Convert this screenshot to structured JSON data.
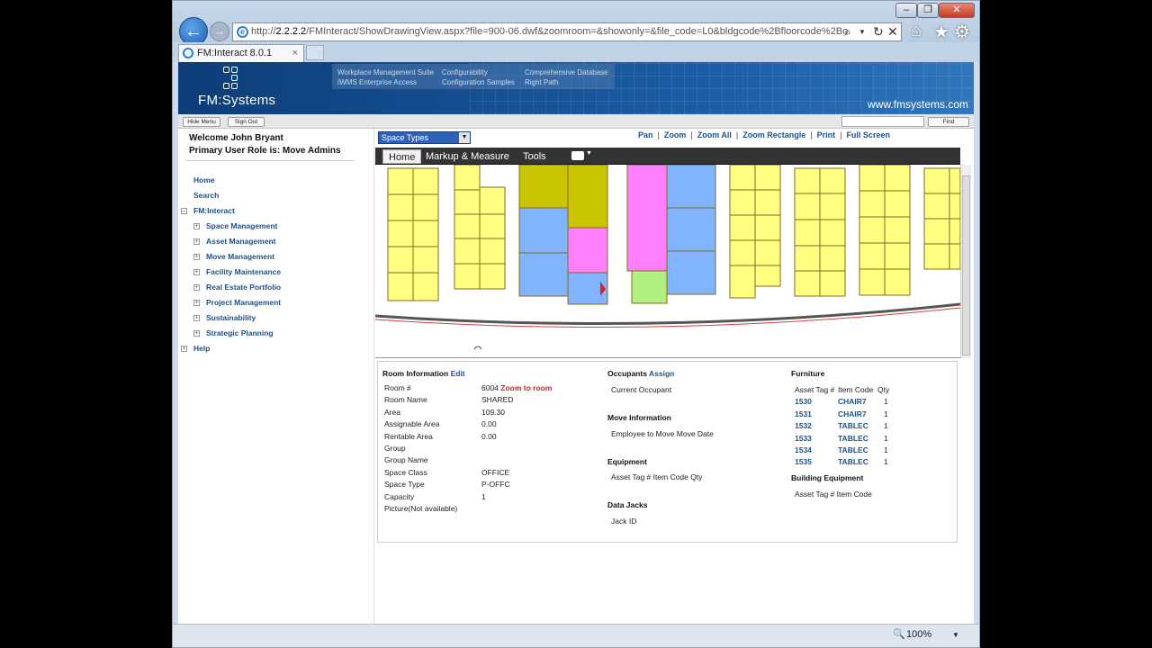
{
  "browser": {
    "url_prefix": "http://",
    "url_host": "2.2.2.2",
    "url_rest": "/FMInteract/ShowDrawingView.aspx?file=900-06.dwf&zoomroom=&showonly=&file_code=L0&bldgcode%2Bfloorcode%2Bo",
    "tab_title": "FM:Interact 8.0.1",
    "tab_close": "×",
    "zoom": "100%",
    "win_buttons": [
      "–",
      "❐",
      "✕"
    ]
  },
  "banner": {
    "logo_text": "FM:Systems",
    "site": "www.fmsystems.com",
    "links": [
      "Workplace Management Suite",
      "IWMS Enterprise Access",
      "Configurability",
      "Configuration Samples",
      "Comprehensive Database",
      "Right Path"
    ]
  },
  "toolbar": {
    "hide_menu": "Hide Menu",
    "sign_out": "Sign Out",
    "find": "Find"
  },
  "user": {
    "welcome": "Welcome John Bryant",
    "role": "Primary User Role is:  Move Admins"
  },
  "nav": {
    "home": "Home",
    "search": "Search",
    "fminteract": "FM:Interact",
    "items": [
      "Space Management",
      "Asset Management",
      "Move Management",
      "Facility Maintenance",
      "Real Estate Portfolio",
      "Project Management",
      "Sustainability",
      "Strategic Planning"
    ],
    "help": "Help"
  },
  "drawing": {
    "select_value": "Space Types",
    "view_links": [
      "Pan",
      "Zoom",
      "Zoom All",
      "Zoom Rectangle",
      "Print",
      "Full Screen"
    ],
    "tabs": [
      "Home",
      "Markup & Measure",
      "Tools"
    ],
    "colors": {
      "yellow": "#ffff80",
      "olive": "#c8c400",
      "blue": "#80b4ff",
      "pink": "#ff80ff",
      "green": "#b0f080"
    }
  },
  "room_info": {
    "heading": "Room Information",
    "edit": "Edit",
    "zoom_to_room": "Zoom to room",
    "fields": [
      {
        "label": "Room #",
        "value": "6004"
      },
      {
        "label": "Room Name",
        "value": "SHARED"
      },
      {
        "label": "Area",
        "value": "109.30"
      },
      {
        "label": "Assignable Area",
        "value": "0.00"
      },
      {
        "label": "Rentable Area",
        "value": "0.00"
      },
      {
        "label": "Group",
        "value": ""
      },
      {
        "label": "Group Name",
        "value": ""
      },
      {
        "label": "Space Class",
        "value": "OFFICE"
      },
      {
        "label": "Space Type",
        "value": "P-OFFC"
      },
      {
        "label": "Capacity",
        "value": "1"
      },
      {
        "label": "Picture(Not available)",
        "value": ""
      }
    ]
  },
  "occupants": {
    "heading": "Occupants",
    "assign": "Assign",
    "current": "Current Occupant",
    "move_heading": "Move Information",
    "move_cols": "Employee to Move Move Date",
    "equip_heading": "Equipment",
    "equip_cols": "Asset Tag # Item Code Qty",
    "jacks_heading": "Data Jacks",
    "jacks_cols": "Jack ID"
  },
  "furniture": {
    "heading": "Furniture",
    "cols": [
      "Asset Tag #",
      "Item Code",
      "Qty"
    ],
    "rows": [
      {
        "tag": "1530",
        "code": "CHAIR7",
        "qty": "1"
      },
      {
        "tag": "1531",
        "code": "CHAIR7",
        "qty": "1"
      },
      {
        "tag": "1532",
        "code": "TABLEC",
        "qty": "1"
      },
      {
        "tag": "1533",
        "code": "TABLEC",
        "qty": "1"
      },
      {
        "tag": "1534",
        "code": "TABLEC",
        "qty": "1"
      },
      {
        "tag": "1535",
        "code": "TABLEC",
        "qty": "1"
      }
    ],
    "building_heading": "Building Equipment",
    "building_cols": "Asset Tag # Item Code"
  }
}
